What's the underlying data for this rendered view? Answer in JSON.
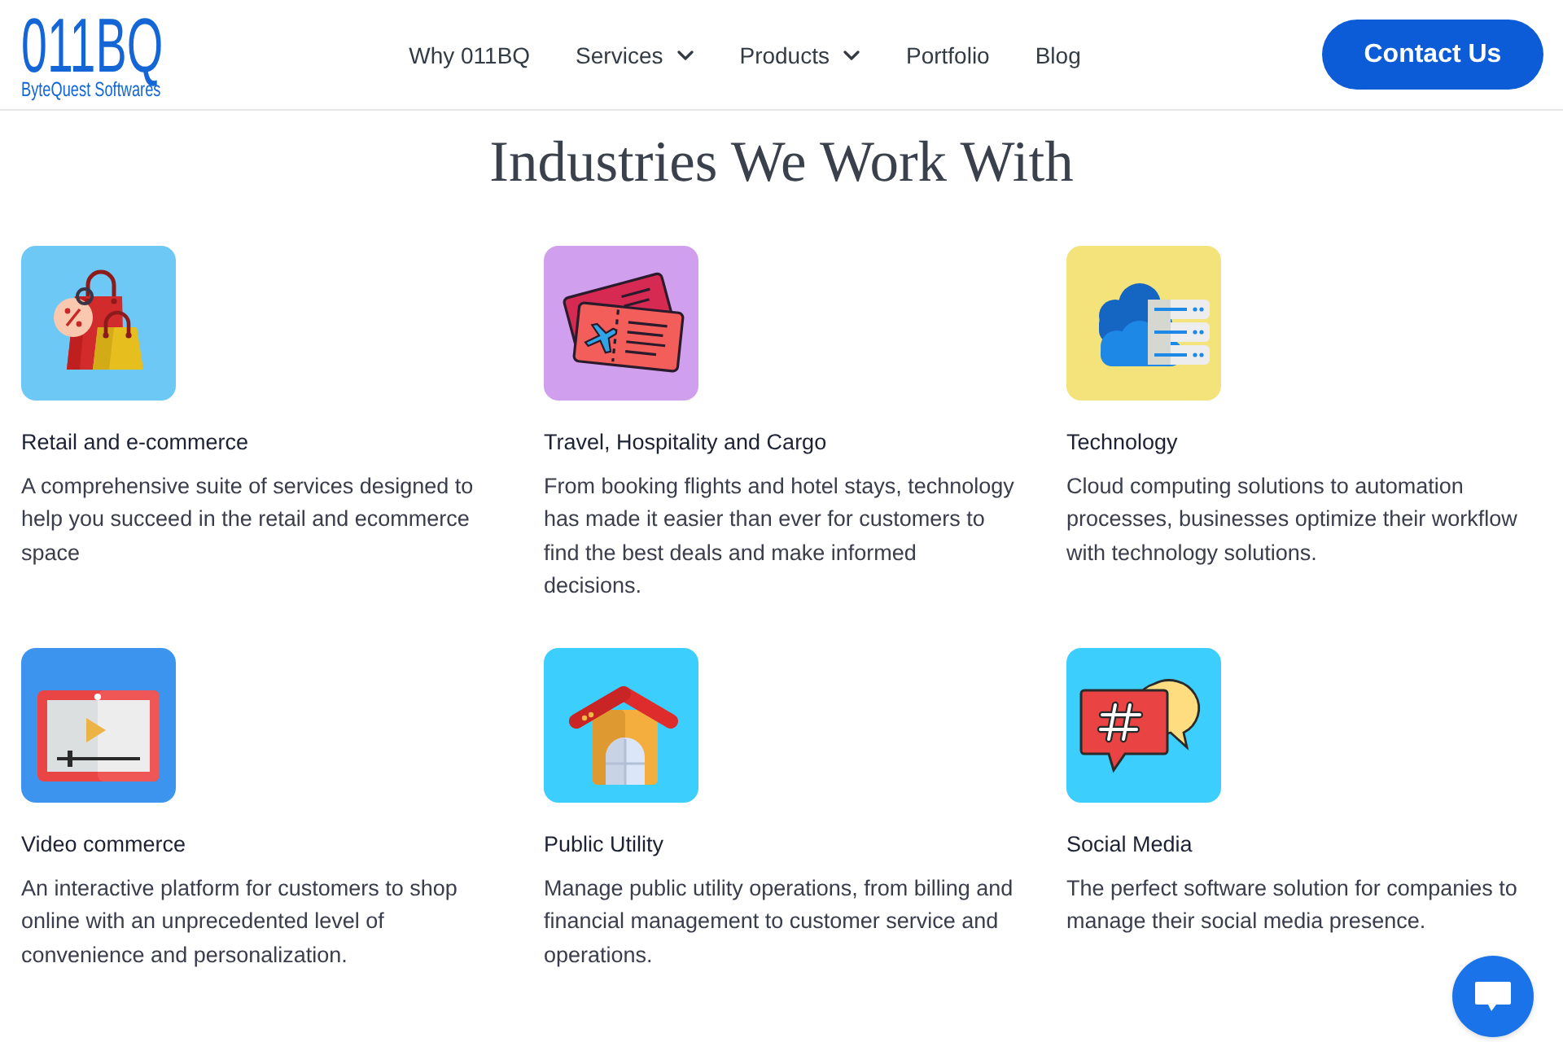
{
  "header": {
    "logo": {
      "wordmark": "011BQ",
      "tagline": "ByteQuest Softwares"
    },
    "nav": [
      {
        "label": "Why 011BQ",
        "dropdown": false
      },
      {
        "label": "Services",
        "dropdown": true
      },
      {
        "label": "Products",
        "dropdown": true
      },
      {
        "label": "Portfolio",
        "dropdown": false
      },
      {
        "label": "Blog",
        "dropdown": false
      }
    ],
    "contact_button": "Contact Us"
  },
  "main": {
    "title": "Industries We Work With",
    "industries": [
      {
        "title": "Retail and e-commerce",
        "description": "A comprehensive suite of services designed to help you succeed in the retail and ecommerce space"
      },
      {
        "title": "Travel, Hospitality and Cargo",
        "description": "From booking flights and hotel stays, technology has made it easier than ever for customers to find the best deals and make informed decisions."
      },
      {
        "title": "Technology",
        "description": "Cloud computing solutions to automation processes, businesses optimize their workflow with technology solutions."
      },
      {
        "title": "Video commerce",
        "description": "An interactive platform for customers to shop online with an unprecedented level of convenience and personalization."
      },
      {
        "title": "Public Utility",
        "description": "Manage public utility operations, from billing and financial management to customer service and operations."
      },
      {
        "title": "Social Media",
        "description": "The perfect software solution for companies to manage their social media presence."
      }
    ]
  }
}
